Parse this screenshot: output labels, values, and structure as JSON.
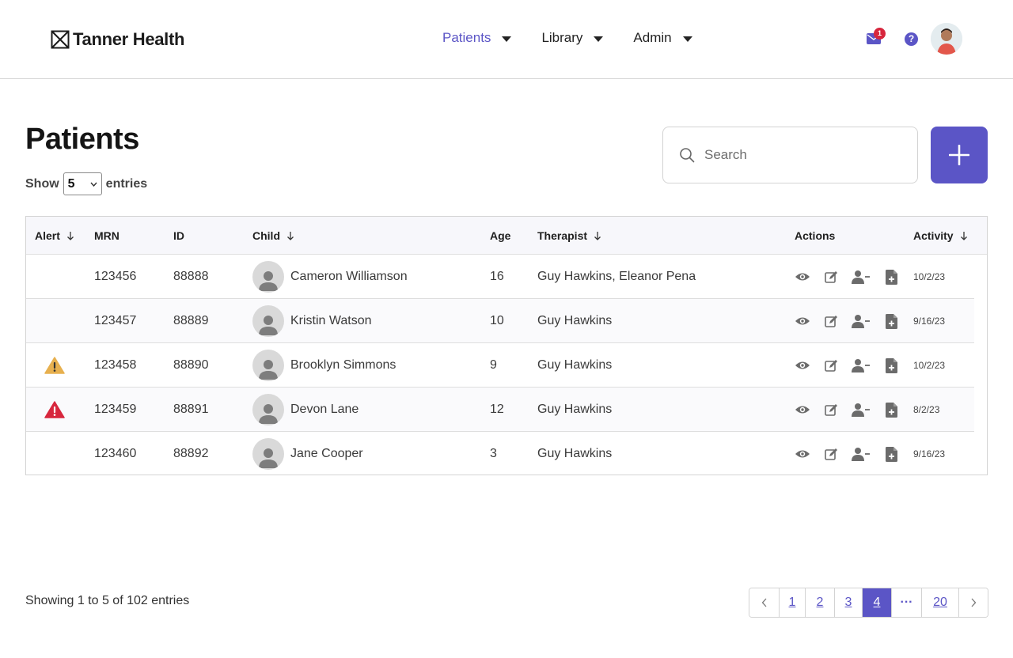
{
  "brand": {
    "name": "Tanner Health",
    "accent": "#5b55c6"
  },
  "nav": [
    {
      "label": "Patients",
      "active": true
    },
    {
      "label": "Library",
      "active": false
    },
    {
      "label": "Admin",
      "active": false
    }
  ],
  "header": {
    "mail_count": "1",
    "help_icon": "question-icon",
    "help_glyph": "?"
  },
  "page": {
    "title": "Patients",
    "show_label": "Show",
    "entries_value": "5",
    "entries_label": "entries",
    "search_placeholder": "Search"
  },
  "table": {
    "headers": {
      "alert": "Alert",
      "mrn": "MRN",
      "id": "ID",
      "child": "Child",
      "age": "Age",
      "therapist": "Therapist",
      "actions": "Actions",
      "activity": "Activity"
    },
    "rows": [
      {
        "alert": "",
        "mrn": "123456",
        "id": "88888",
        "child": "Cameron Williamson",
        "age": "16",
        "therapist": "Guy Hawkins, Eleanor Pena",
        "activity": "10/2/23"
      },
      {
        "alert": "",
        "mrn": "123457",
        "id": "88889",
        "child": "Kristin Watson",
        "age": "10",
        "therapist": "Guy Hawkins",
        "activity": "9/16/23"
      },
      {
        "alert": "warning",
        "mrn": "123458",
        "id": "88890",
        "child": "Brooklyn Simmons",
        "age": "9",
        "therapist": "Guy Hawkins",
        "activity": "10/2/23"
      },
      {
        "alert": "critical",
        "mrn": "123459",
        "id": "88891",
        "child": "Devon Lane",
        "age": "12",
        "therapist": "Guy Hawkins",
        "activity": "8/2/23"
      },
      {
        "alert": "",
        "mrn": "123460",
        "id": "88892",
        "child": "Jane Cooper",
        "age": "3",
        "therapist": "Guy Hawkins",
        "activity": "9/16/23"
      }
    ],
    "alert_colors": {
      "warning": "#e7b04f",
      "critical": "#d7263d"
    }
  },
  "footer": {
    "showing": "Showing 1 to 5 of 102 entries",
    "pages": [
      "1",
      "2",
      "3",
      "4",
      "···",
      "20"
    ],
    "current_page": "4"
  }
}
